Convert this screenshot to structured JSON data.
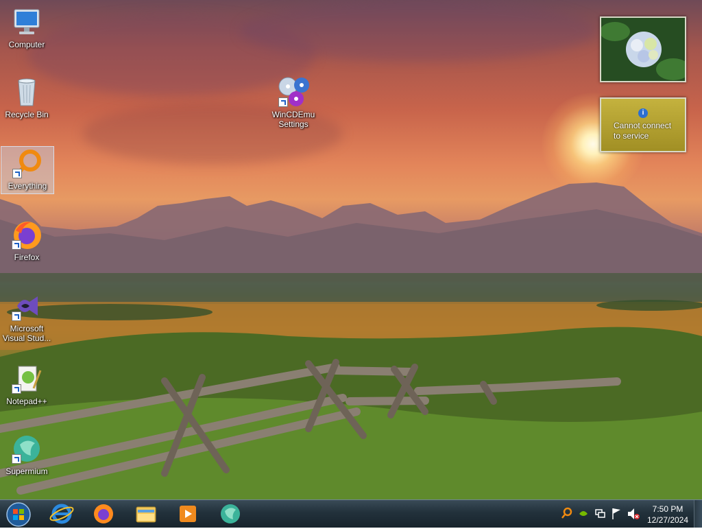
{
  "desktop_icons": [
    {
      "label": "Computer"
    },
    {
      "label": "Recycle Bin"
    },
    {
      "label": "Everything"
    },
    {
      "label": "Firefox"
    },
    {
      "label": "Microsoft Visual Stud..."
    },
    {
      "label": "Notepad++"
    },
    {
      "label": "Supermium"
    },
    {
      "label": "WinCDEmu Settings"
    }
  ],
  "gadgets": {
    "slideshow": {
      "icon": "flower-photo"
    },
    "weather": {
      "message": "Cannot connect to service",
      "icon": "info-icon"
    }
  },
  "taskbar": {
    "pinned": [
      {
        "name": "internet-explorer-icon"
      },
      {
        "name": "firefox-icon"
      },
      {
        "name": "file-explorer-icon"
      },
      {
        "name": "media-player-icon"
      },
      {
        "name": "supermium-icon"
      }
    ],
    "clock": {
      "time": "7:50 PM",
      "date": "12/27/2024"
    }
  },
  "colors": {
    "taskbar": "#22313b",
    "gadget_weather_bg": "#b0a030"
  }
}
